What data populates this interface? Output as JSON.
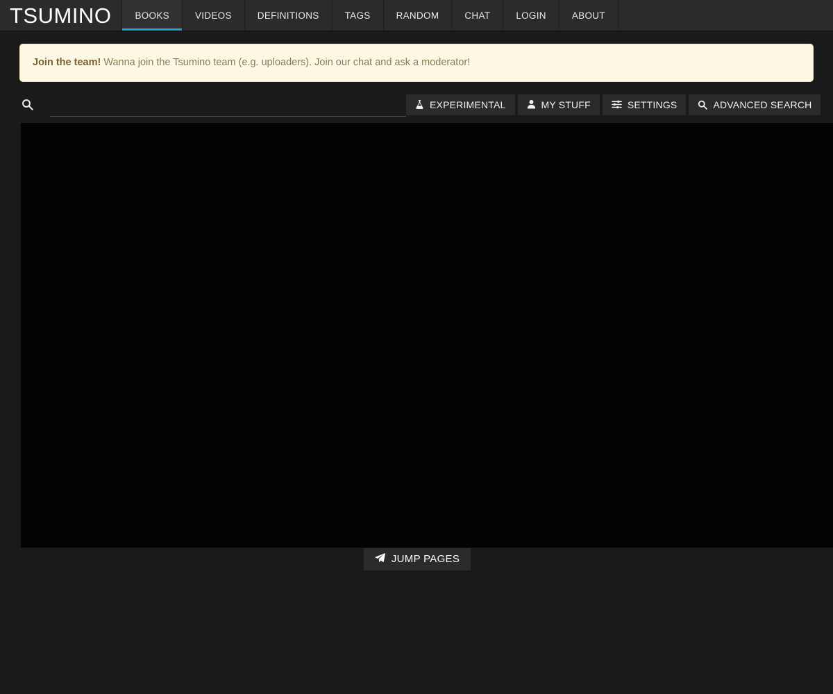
{
  "site": {
    "brand": "TSUMINO"
  },
  "nav": {
    "items": [
      {
        "label": "BOOKS",
        "active": true
      },
      {
        "label": "VIDEOS",
        "active": false
      },
      {
        "label": "DEFINITIONS",
        "active": false
      },
      {
        "label": "TAGS",
        "active": false
      },
      {
        "label": "RANDOM",
        "active": false
      },
      {
        "label": "CHAT",
        "active": false
      },
      {
        "label": "LOGIN",
        "active": false
      },
      {
        "label": "ABOUT",
        "active": false
      }
    ],
    "active_accent_color": "#2a9fd6"
  },
  "alert": {
    "title": "Join the team!",
    "message": "Wanna join the Tsumino team (e.g. uploaders). Join our chat and ask a moderator!",
    "background_color": "#fcf8e3",
    "text_color": "#8a6d3b"
  },
  "search": {
    "icon": "search-icon",
    "value": "",
    "placeholder": ""
  },
  "toolbar": {
    "buttons": [
      {
        "label": "EXPERIMENTAL",
        "icon": "flask-icon"
      },
      {
        "label": "MY STUFF",
        "icon": "user-icon"
      },
      {
        "label": "SETTINGS",
        "icon": "sliders-icon"
      },
      {
        "label": "ADVANCED SEARCH",
        "icon": "search-icon"
      }
    ]
  },
  "content": {
    "background_color": "#030303"
  },
  "footer": {
    "jump_pages_label": "JUMP PAGES",
    "jump_pages_icon": "paper-plane-icon"
  }
}
